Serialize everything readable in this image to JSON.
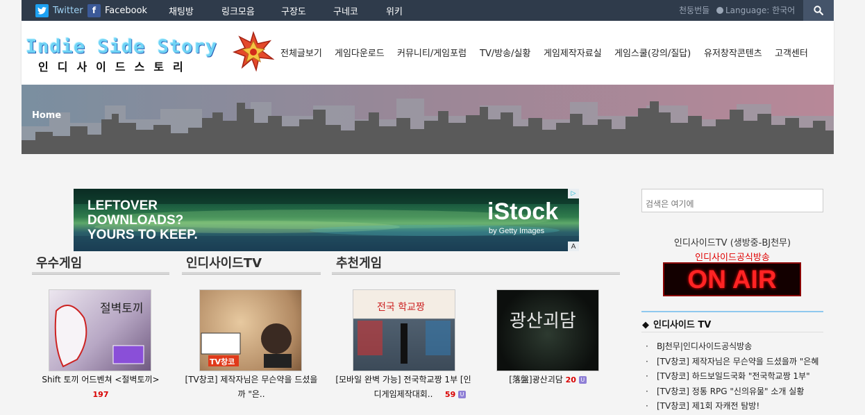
{
  "topbar": {
    "social": [
      {
        "label": "Twitter",
        "icon": "twitter-icon",
        "color": "#1da1f2"
      },
      {
        "label": "Facebook",
        "icon": "facebook-icon",
        "color": "#3b5998"
      }
    ],
    "menu": [
      "채팅방",
      "링크모음",
      "구장도",
      "구네코",
      "위키"
    ],
    "user_link": "천둥번들",
    "language": "Language: 한국어"
  },
  "header": {
    "logo_text": "Indie Side Story",
    "logo_sub": "인디사이드스토리",
    "nav": [
      "전체글보기",
      "게임다운로드",
      "커뮤니티/게임포럼",
      "TV/방송/실황",
      "게임제작자료실",
      "게임스쿨(강의/질답)",
      "유저창작콘텐츠",
      "고객센터"
    ]
  },
  "banner": {
    "breadcrumb": "Home"
  },
  "ad": {
    "left_text": [
      "LEFTOVER",
      "DOWNLOADS?",
      "YOURS TO KEEP."
    ],
    "brand": "iStock",
    "brand_sub": "by Getty Images"
  },
  "sections": [
    {
      "title": "우수게임"
    },
    {
      "title": "인디사이드TV"
    },
    {
      "title": "추천게임"
    }
  ],
  "cards": [
    {
      "thumb_text": "절벽토끼",
      "caption": "Shift 토끼 어드벤쳐 <절벽토끼>",
      "count": "197",
      "has_badge": false
    },
    {
      "thumb_text": "TV창코",
      "caption": "[TV창코] 제작자님은 무슨약을 드셨을까 \"은..",
      "count": "",
      "has_badge": false
    },
    {
      "thumb_text": "전국 학교짱",
      "caption": "[모바일 완벽 가능] 전국학교짱 1부 [인디게임제작대회..",
      "count": "59",
      "has_badge": true
    },
    {
      "thumb_text": "광산괴담",
      "caption": "[落盤]광산괴담",
      "count": "20",
      "has_badge": true
    }
  ],
  "sidebar": {
    "search_placeholder": "검색은 여기에",
    "tv_title": "인디사이드TV (생방중-BJ천무)",
    "tv_red": "인디사이드공식방송",
    "onair": "ON AIR",
    "list_title": "인디사이드 TV",
    "list": [
      "BJ천무|인디사이드공식방송",
      "[TV창코] 제작자님은 무슨약을 드셨을까 \"은혜",
      "[TV창코] 하드보일드국화 \"전국학교짱 1부\"",
      "[TV창코] 정통 RPG \"신의유물\" 소개 실황",
      "[TV창코] 제1회 자캐전 탐방!"
    ]
  }
}
